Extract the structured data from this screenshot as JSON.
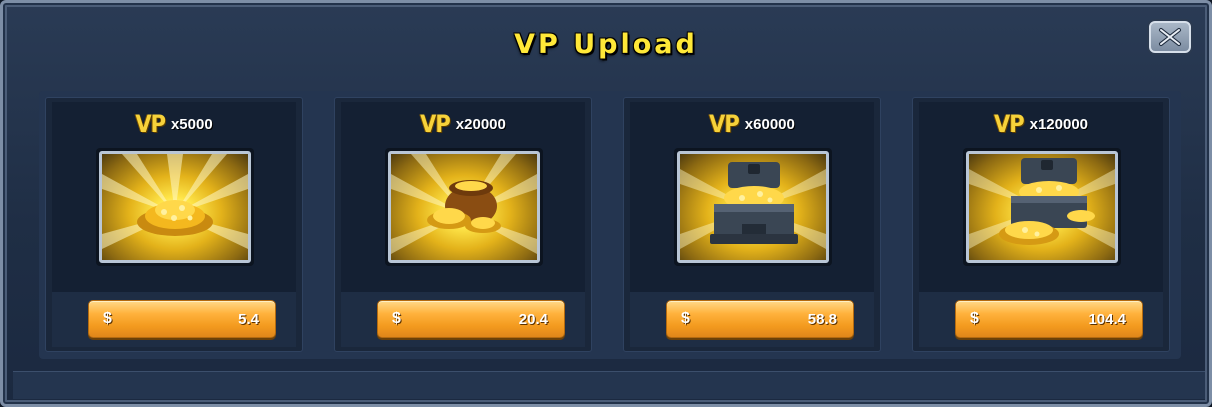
{
  "dialog": {
    "title": "VP Upload",
    "close_icon": "close-icon"
  },
  "packages": [
    {
      "currency_logo": "VP",
      "quantity": "x5000",
      "currency_symbol": "$",
      "price": "5.4",
      "icon": "gold-pile-icon"
    },
    {
      "currency_logo": "VP",
      "quantity": "x20000",
      "currency_symbol": "$",
      "price": "20.4",
      "icon": "gold-sack-icon"
    },
    {
      "currency_logo": "VP",
      "quantity": "x60000",
      "currency_symbol": "$",
      "price": "58.8",
      "icon": "treasure-chest-icon"
    },
    {
      "currency_logo": "VP",
      "quantity": "x120000",
      "currency_symbol": "$",
      "price": "104.4",
      "icon": "treasure-chest-large-icon"
    }
  ],
  "colors": {
    "title": "#ffe838",
    "vp_logo": "#f7d23a",
    "button": "#f39a1e",
    "panel": "#1f2e45"
  }
}
